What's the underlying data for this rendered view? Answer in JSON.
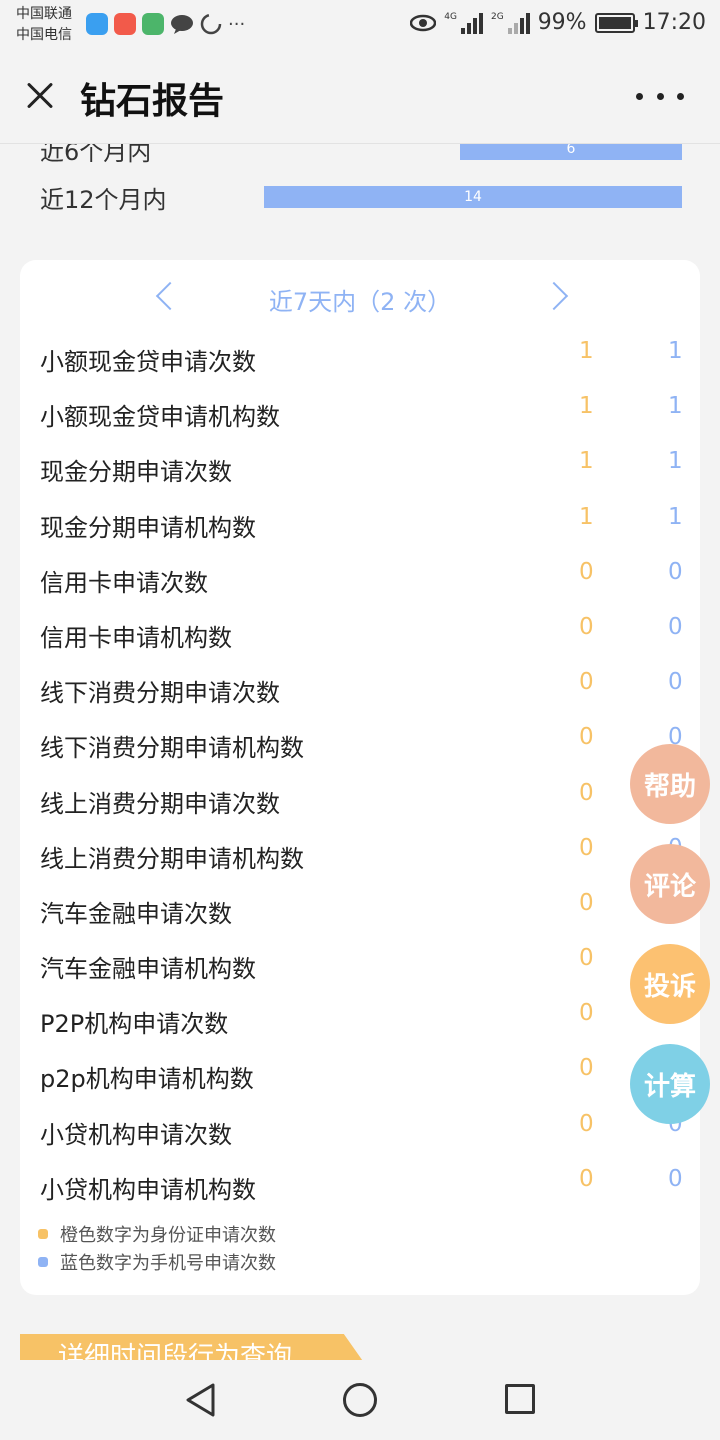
{
  "status": {
    "carrier1": "中国联通",
    "carrier2": "中国电信",
    "net1": "4G",
    "net2": "2G",
    "battery": "99%",
    "time": "17:20"
  },
  "header": {
    "title": "钻石报告"
  },
  "top_bars": [
    {
      "label": "近6个月内",
      "value": "6"
    },
    {
      "label": "近12个月内",
      "value": "14"
    }
  ],
  "period": {
    "title": "近7天内（2 次）"
  },
  "rows": [
    {
      "name": "小额现金贷申请次数",
      "id_count": "1",
      "phone_count": "1"
    },
    {
      "name": "小额现金贷申请机构数",
      "id_count": "1",
      "phone_count": "1"
    },
    {
      "name": "现金分期申请次数",
      "id_count": "1",
      "phone_count": "1"
    },
    {
      "name": "现金分期申请机构数",
      "id_count": "1",
      "phone_count": "1"
    },
    {
      "name": "信用卡申请次数",
      "id_count": "0",
      "phone_count": "0"
    },
    {
      "name": "信用卡申请机构数",
      "id_count": "0",
      "phone_count": "0"
    },
    {
      "name": "线下消费分期申请次数",
      "id_count": "0",
      "phone_count": "0"
    },
    {
      "name": "线下消费分期申请机构数",
      "id_count": "0",
      "phone_count": "0"
    },
    {
      "name": "线上消费分期申请次数",
      "id_count": "0",
      "phone_count": "0"
    },
    {
      "name": "线上消费分期申请机构数",
      "id_count": "0",
      "phone_count": "0"
    },
    {
      "name": "汽车金融申请次数",
      "id_count": "0",
      "phone_count": "0"
    },
    {
      "name": "汽车金融申请机构数",
      "id_count": "0",
      "phone_count": "0"
    },
    {
      "name": "P2P机构申请次数",
      "id_count": "0",
      "phone_count": "0"
    },
    {
      "name": "p2p机构申请机构数",
      "id_count": "0",
      "phone_count": "0"
    },
    {
      "name": "小贷机构申请次数",
      "id_count": "0",
      "phone_count": "0"
    },
    {
      "name": "小贷机构申请机构数",
      "id_count": "0",
      "phone_count": "0"
    }
  ],
  "legend": {
    "orange": "橙色数字为身份证申请次数",
    "blue": "蓝色数字为手机号申请次数"
  },
  "floating": {
    "help": "帮助",
    "comment": "评论",
    "complaint": "投诉",
    "calculate": "计算"
  },
  "detail_tab": "详细时间段行为查询",
  "colors": {
    "orange": "#f7c266",
    "blue": "#8fb3f4",
    "help": "#f2b89c",
    "complaint": "#fcc171",
    "calculate": "#7fd0e6"
  }
}
